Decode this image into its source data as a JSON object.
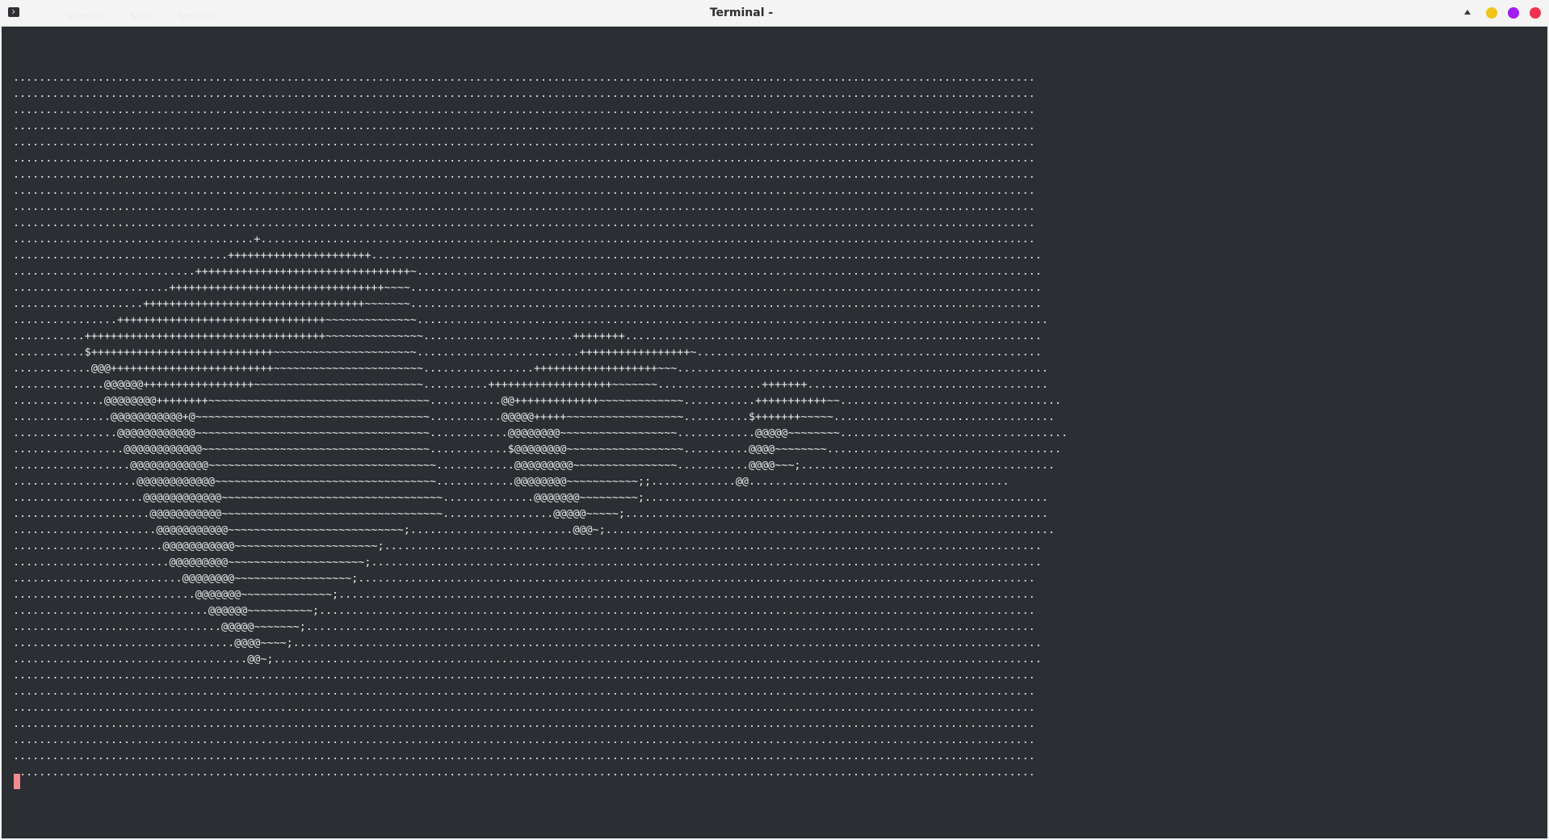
{
  "window": {
    "title": "Terminal -",
    "ghost_tabs": [
      "~",
      "Terminal",
      "Shell",
      "Session"
    ],
    "controls": {
      "collapse_icon": "triangle-up-icon",
      "minimize_color": "#f2c318",
      "maximize_color": "#a21cf0",
      "close_color": "#f0334f"
    }
  },
  "terminal": {
    "background": "#2b2e33",
    "foreground": "#e8e8e8",
    "cursor_color": "#f28b8e",
    "lines": [
      "",
      ".............................................................................................................................................................",
      ".............................................................................................................................................................",
      ".............................................................................................................................................................",
      ".............................................................................................................................................................",
      ".............................................................................................................................................................",
      ".............................................................................................................................................................",
      ".............................................................................................................................................................",
      ".............................................................................................................................................................",
      ".............................................................................................................................................................",
      ".............................................................................................................................................................",
      ".....................................+.......................................................................................................................",
      ".................................++++++++++++++++++++++.......................................................................................................",
      "............................+++++++++++++++++++++++++++++++++~................................................................................................",
      "........................+++++++++++++++++++++++++++++++++~~~~.................................................................................................",
      "....................++++++++++++++++++++++++++++++++++~~~~~~~.................................................................................................",
      "................++++++++++++++++++++++++++++++++~~~~~~~~~~~~~~.................................................................................................",
      "...........+++++++++++++++++++++++++++++++++++++~~~~~~~~~~~~~~~.......................++++++++................................................................",
      "...........$++++++++++++++++++++++++++++~~~~~~~~~~~~~~~~~~~~~~.........................+++++++++++++++++~.....................................................",
      "............@@@+++++++++++++++++++++++++~~~~~~~~~~~~~~~~~~~~~~~.................+++++++++++++++++++~~~.........................................................",
      "..............@@@@@@+++++++++++++++++~~~~~~~~~~~~~~~~~~~~~~~~~~..........+++++++++++++++++++~~~~~~~................+++++++.....................................",
      "..............@@@@@@@@++++++++~~~~~~~~~~~~~~~~~~~~~~~~~~~~~~~~~~...........@@+++++++++++++~~~~~~~~~~~~~...........+++++++++++~~..................................",
      "...............@@@@@@@@@@@+@~~~~~~~~~~~~~~~~~~~~~~~~~~~~~~~~~~~~...........@@@@@+++++~~~~~~~~~~~~~~~~~~..........$+++++++~~~~~..................................",
      "................@@@@@@@@@@@@~~~~~~~~~~~~~~~~~~~~~~~~~~~~~~~~~~~~............@@@@@@@@~~~~~~~~~~~~~~~~~~............@@@@@~~~~~~~~...................................",
      ".................@@@@@@@@@@@@~~~~~~~~~~~~~~~~~~~~~~~~~~~~~~~~~~~............$@@@@@@@@~~~~~~~~~~~~~~~~~~..........@@@@~~~~~~~~....................................",
      "..................@@@@@@@@@@@@~~~~~~~~~~~~~~~~~~~~~~~~~~~~~~~~~~~............@@@@@@@@@~~~~~~~~~~~~~~~~...........@@@@~~~;.......................................",
      "...................@@@@@@@@@@@@~~~~~~~~~~~~~~~~~~~~~~~~~~~~~~~~~~............@@@@@@@@~~~~~~~~~~~;;.............@@........................................",
      "....................@@@@@@@@@@@@~~~~~~~~~~~~~~~~~~~~~~~~~~~~~~~~~~..............@@@@@@@~~~~~~~~~;..............................................................",
      ".....................@@@@@@@@@@@~~~~~~~~~~~~~~~~~~~~~~~~~~~~~~~~~~.................@@@@@~~~~~;.................................................................",
      "......................@@@@@@@@@@@~~~~~~~~~~~~~~~~~~~~~~~~~~~;.........................@@@~;.....................................................................",
      ".......................@@@@@@@@@@@~~~~~~~~~~~~~~~~~~~~~~;.....................................................................................................",
      "........................@@@@@@@@@~~~~~~~~~~~~~~~~~~~~~;.......................................................................................................",
      "..........................@@@@@@@@~~~~~~~~~~~~~~~~~~;........................................................................................................",
      "............................@@@@@@@~~~~~~~~~~~~~~;...........................................................................................................",
      "..............................@@@@@@~~~~~~~~~~;..............................................................................................................",
      "................................@@@@@~~~~~~~;................................................................................................................",
      "..................................@@@@~~~~;...................................................................................................................",
      "....................................@@~;......................................................................................................................",
      ".............................................................................................................................................................",
      ".............................................................................................................................................................",
      ".............................................................................................................................................................",
      ".............................................................................................................................................................",
      ".............................................................................................................................................................",
      ".............................................................................................................................................................",
      ".............................................................................................................................................................",
      ""
    ]
  }
}
